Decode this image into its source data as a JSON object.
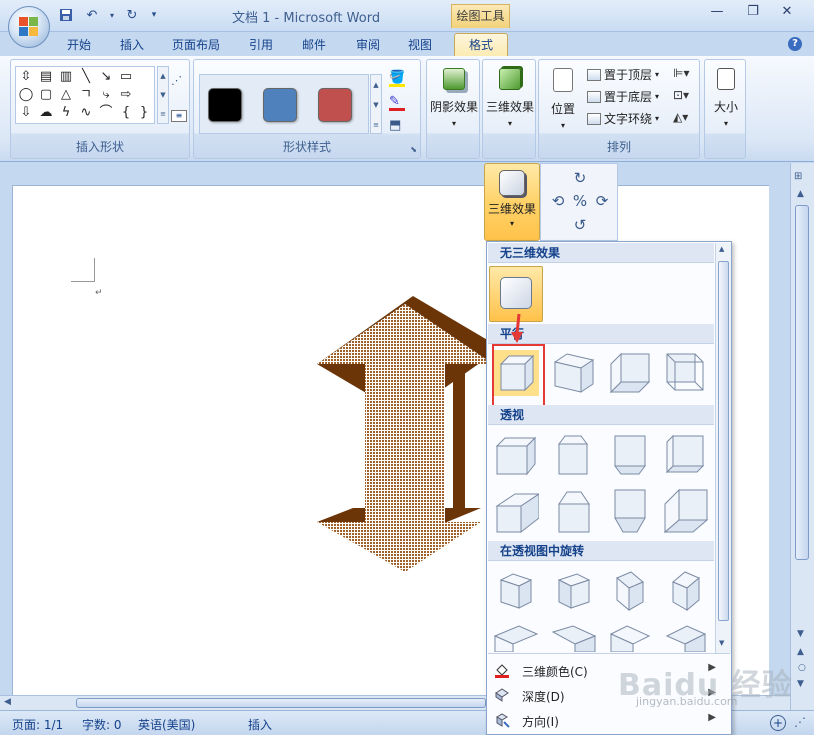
{
  "window": {
    "title": "文档 1 - Microsoft Word",
    "contextual_tab_group": "绘图工具"
  },
  "tabs": [
    "开始",
    "插入",
    "页面布局",
    "引用",
    "邮件",
    "审阅",
    "视图"
  ],
  "active_tab": "格式",
  "ribbon": {
    "insert_shapes_label": "插入形状",
    "shape_styles_label": "形状样式",
    "shape_style_colors": [
      "#000000",
      "#4f81bd",
      "#c0504d"
    ],
    "shadow_effects_label": "阴影效果",
    "threed_effects_label": "三维效果",
    "arrange": {
      "label": "排列",
      "position_label": "位置",
      "bring_to_front": "置于顶层",
      "send_to_back": "置于底层",
      "text_wrap": "文字环绕"
    },
    "size_label": "大小"
  },
  "threed_button_label": "三维效果",
  "gallery": {
    "no_effect_header": "无三维效果",
    "parallel_header": "平行",
    "perspective_header": "透视",
    "rotation_header": "在透视图中旋转",
    "menu": [
      {
        "label": "三维颜色(C)",
        "icon": "paint-bucket-icon"
      },
      {
        "label": "深度(D)",
        "icon": "depth-icon"
      },
      {
        "label": "方向(I)",
        "icon": "direction-icon"
      }
    ]
  },
  "status": {
    "page": "页面: 1/1",
    "words": "字数: 0",
    "language": "英语(美国)",
    "mode": "插入"
  },
  "colors": {
    "arrow_face": "#a0602a",
    "arrow_dark": "#6b3508",
    "highlight": "#ffc24a",
    "selection_box": "#e53935"
  },
  "watermark": {
    "brand": "Baidu 经验",
    "url": "jingyan.baidu.com"
  }
}
